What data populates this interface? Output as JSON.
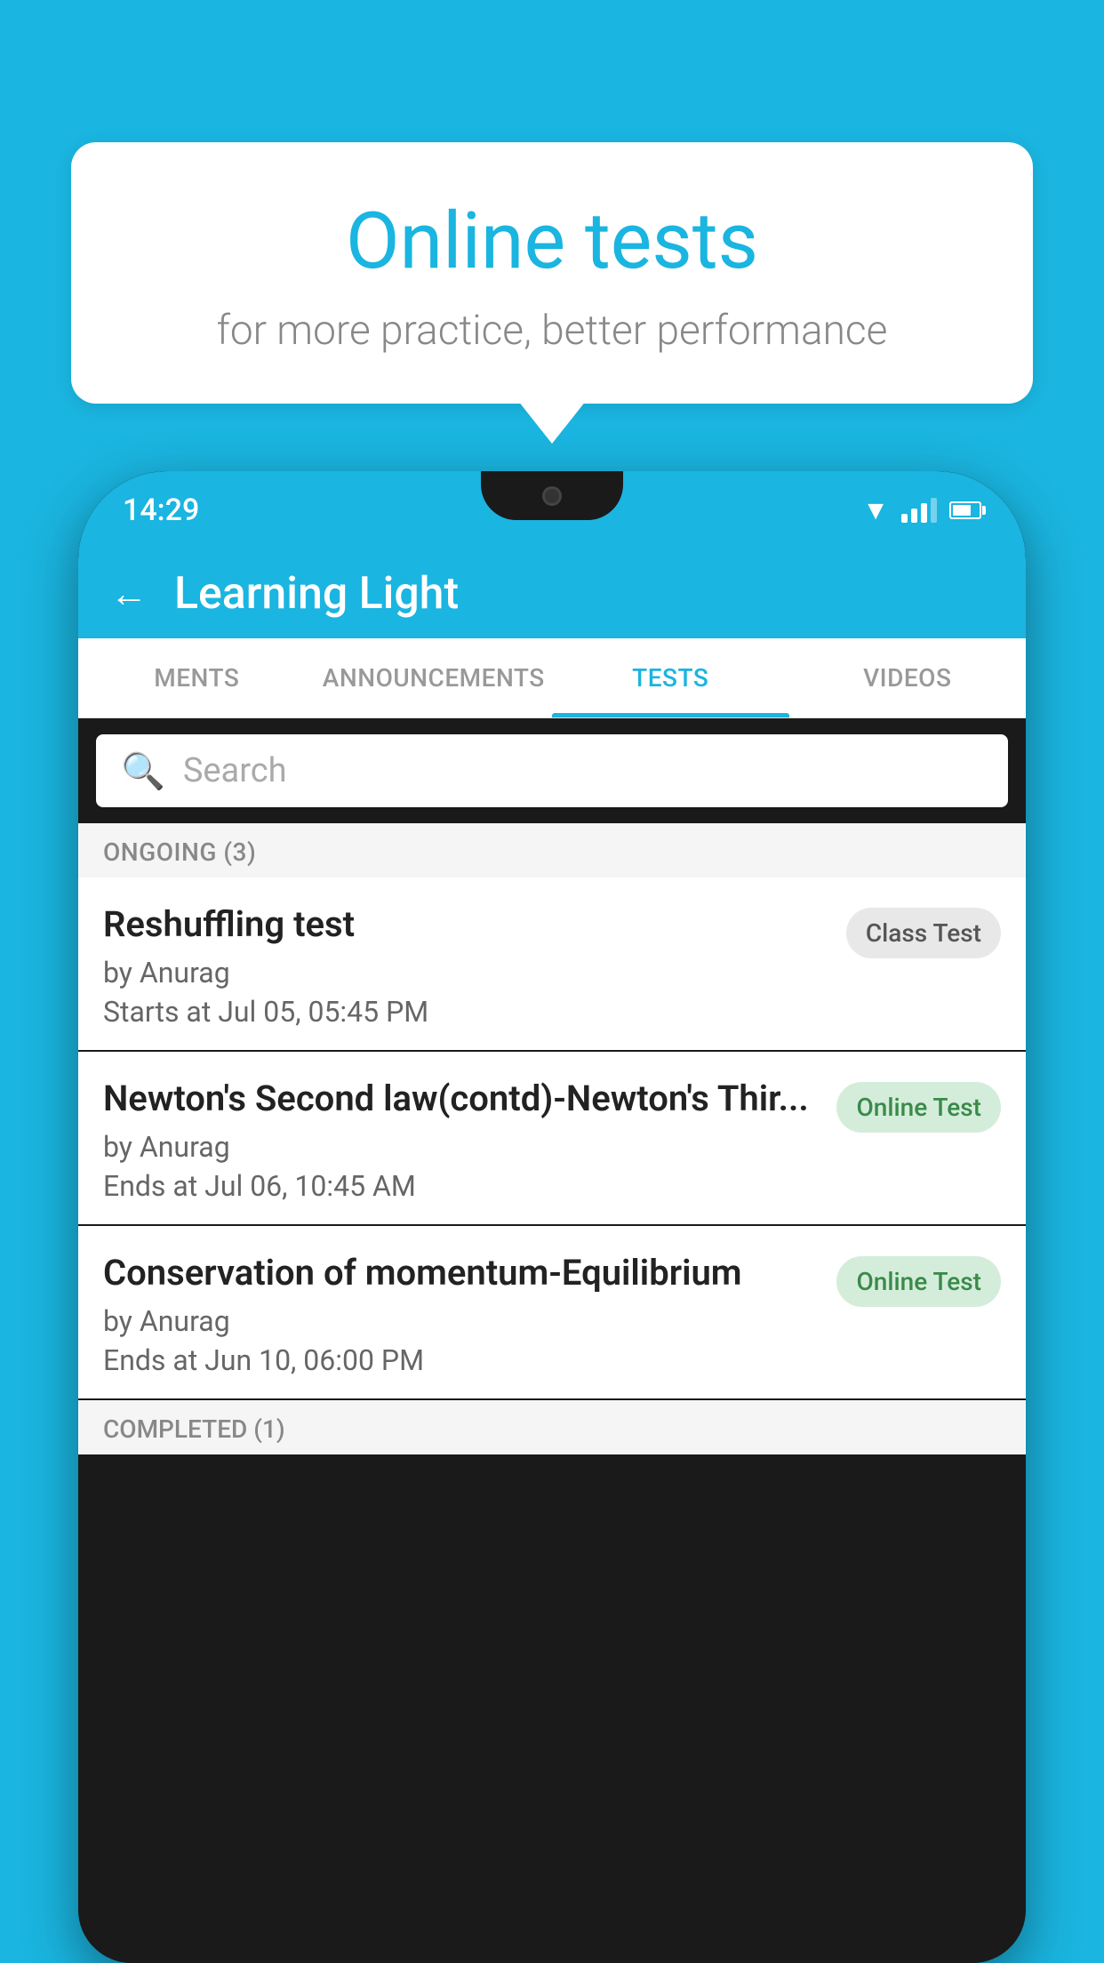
{
  "background_color": "#1ab5e0",
  "bubble": {
    "title": "Online tests",
    "subtitle": "for more practice, better performance"
  },
  "phone": {
    "time": "14:29",
    "header": {
      "back_label": "←",
      "title": "Learning Light"
    },
    "tabs": [
      {
        "label": "MENTS",
        "active": false
      },
      {
        "label": "ANNOUNCEMENTS",
        "active": false
      },
      {
        "label": "TESTS",
        "active": true
      },
      {
        "label": "VIDEOS",
        "active": false
      }
    ],
    "search": {
      "placeholder": "Search"
    },
    "ongoing_section": "ONGOING (3)",
    "tests": [
      {
        "title": "Reshuffling test",
        "author": "by Anurag",
        "time_label": "Starts at",
        "time": "Jul 05, 05:45 PM",
        "badge": "Class Test",
        "badge_type": "class"
      },
      {
        "title": "Newton's Second law(contd)-Newton's Thir...",
        "author": "by Anurag",
        "time_label": "Ends at",
        "time": "Jul 06, 10:45 AM",
        "badge": "Online Test",
        "badge_type": "online"
      },
      {
        "title": "Conservation of momentum-Equilibrium",
        "author": "by Anurag",
        "time_label": "Ends at",
        "time": "Jun 10, 06:00 PM",
        "badge": "Online Test",
        "badge_type": "online"
      }
    ],
    "completed_section": "COMPLETED (1)"
  }
}
